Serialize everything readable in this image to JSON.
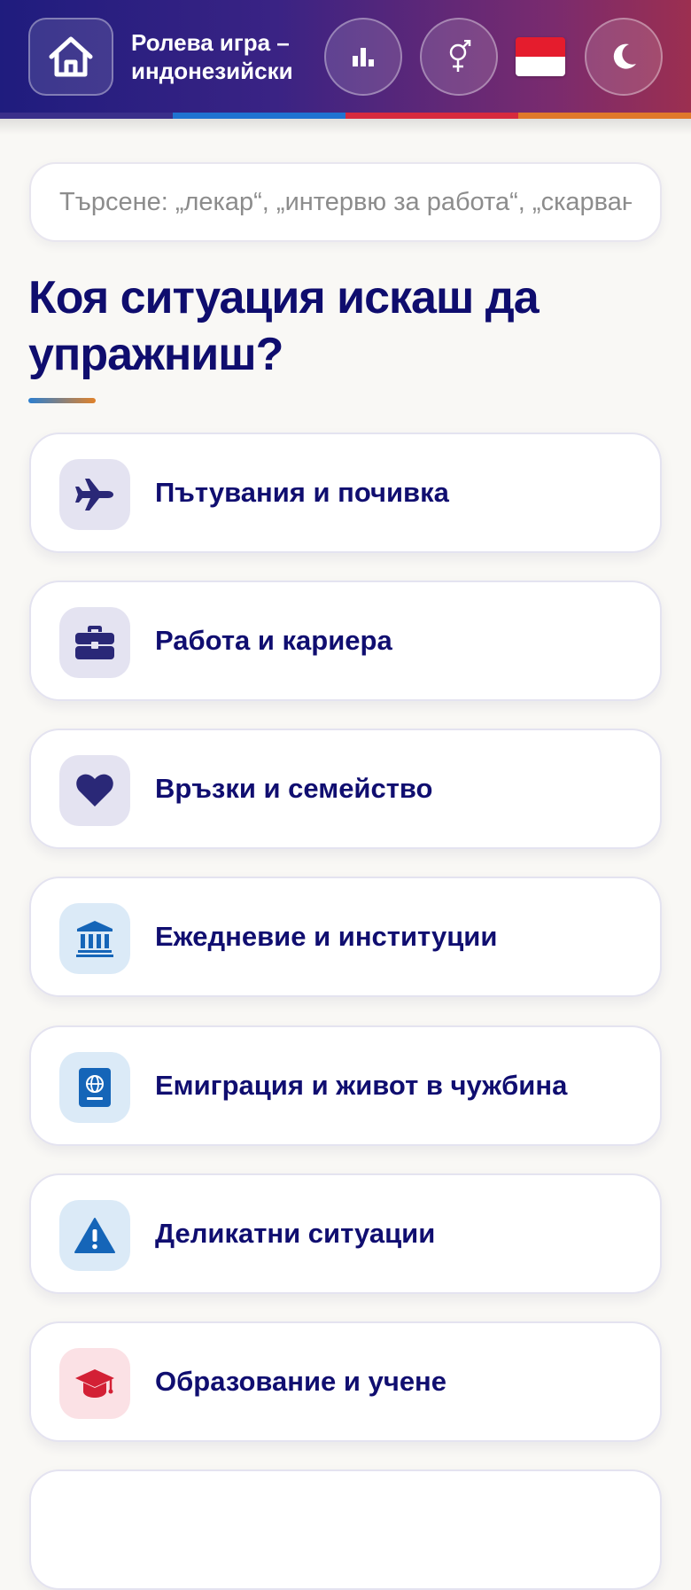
{
  "header": {
    "title": "Ролева игра – индонезийски",
    "home_icon": "home-icon",
    "stats_icon": "bar-chart-icon",
    "gender_icon": "gender-icon",
    "flag": "indonesia-flag",
    "theme_icon": "moon-icon",
    "stripe_colors": [
      "#3a2f8a",
      "#1f73d1",
      "#d72a3e",
      "#e0782a"
    ]
  },
  "search": {
    "placeholder": "Търсене: „лекар“, „интервю за работа“, „скарване“",
    "value": ""
  },
  "heading": "Коя ситуация искаш да упражниш?",
  "categories": [
    {
      "label": "Пътувания и почивка",
      "icon": "airplane-icon",
      "icon_bg": "#e4e3f1",
      "icon_color": "#2a2877"
    },
    {
      "label": "Работа и кариера",
      "icon": "briefcase-icon",
      "icon_bg": "#e4e3f1",
      "icon_color": "#2a2877"
    },
    {
      "label": "Връзки и семейство",
      "icon": "heart-icon",
      "icon_bg": "#e4e3f1",
      "icon_color": "#2a2877"
    },
    {
      "label": "Ежедневие и институции",
      "icon": "institution-icon",
      "icon_bg": "#dbeaf7",
      "icon_color": "#1565b8"
    },
    {
      "label": "Емиграция и живот в чужбина",
      "icon": "passport-icon",
      "icon_bg": "#dbeaf7",
      "icon_color": "#1565b8"
    },
    {
      "label": "Деликатни ситуации",
      "icon": "warning-icon",
      "icon_bg": "#dbeaf7",
      "icon_color": "#1565b8"
    },
    {
      "label": "Образование и учене",
      "icon": "graduation-cap-icon",
      "icon_bg": "#fbe1e5",
      "icon_color": "#d32035"
    }
  ]
}
